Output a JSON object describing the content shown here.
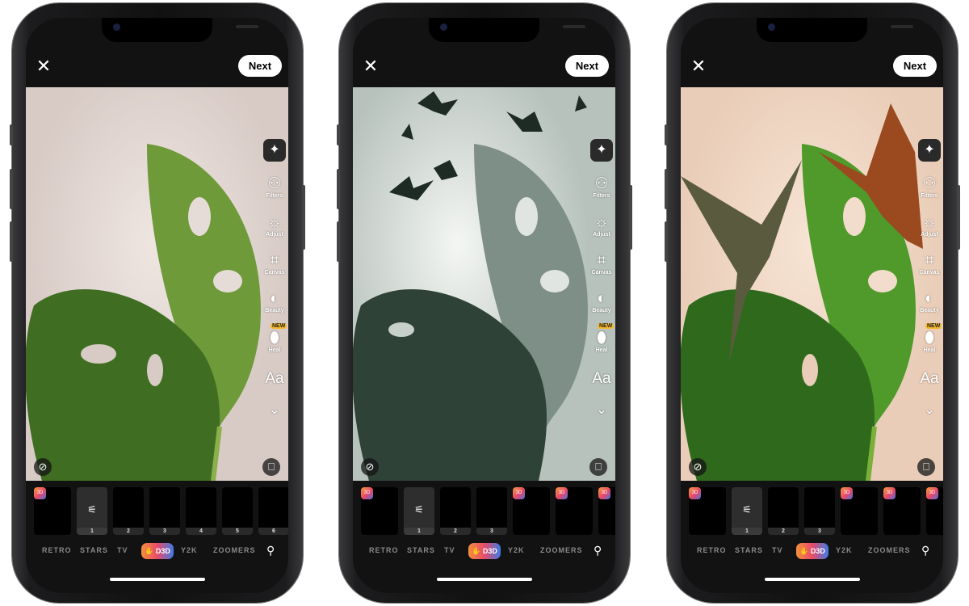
{
  "phones": [
    {
      "id": "original",
      "header": {
        "next_label": "Next"
      },
      "photo_style": "original",
      "thumbnails": [
        {
          "type": "badge"
        },
        {
          "type": "adjust",
          "num": "1"
        },
        {
          "type": "plain",
          "num": "2"
        },
        {
          "type": "plain",
          "num": "3"
        },
        {
          "type": "plain",
          "num": "4"
        },
        {
          "type": "plain",
          "num": "5"
        },
        {
          "type": "plain",
          "num": "6"
        }
      ]
    },
    {
      "id": "bats",
      "header": {
        "next_label": "Next"
      },
      "photo_style": "bats",
      "thumbnails": [
        {
          "type": "badge"
        },
        {
          "type": "adjust",
          "num": "1"
        },
        {
          "type": "plain",
          "num": "2"
        },
        {
          "type": "plain",
          "num": "3"
        },
        {
          "type": "badge"
        },
        {
          "type": "badge"
        },
        {
          "type": "badge"
        }
      ]
    },
    {
      "id": "dragons",
      "header": {
        "next_label": "Next"
      },
      "photo_style": "dragons",
      "thumbnails": [
        {
          "type": "badge"
        },
        {
          "type": "adjust",
          "num": "1"
        },
        {
          "type": "plain",
          "num": "2"
        },
        {
          "type": "plain",
          "num": "3"
        },
        {
          "type": "badge"
        },
        {
          "type": "badge"
        },
        {
          "type": "badge"
        }
      ]
    }
  ],
  "tools": [
    {
      "name": "filters",
      "label": "Filters",
      "icon": "filters-icon"
    },
    {
      "name": "adjust",
      "label": "Adjust",
      "icon": "adjust-icon"
    },
    {
      "name": "canvas",
      "label": "Canvas",
      "icon": "crop-icon"
    },
    {
      "name": "beauty",
      "label": "Beauty",
      "icon": "beauty-icon"
    },
    {
      "name": "heal",
      "label": "Heal",
      "icon": "bandage-icon",
      "badge": "NEW"
    }
  ],
  "text_tool": "Aa",
  "badge_text": "D3D",
  "categories": [
    "RETRO",
    "STARS",
    "TV",
    "D3D",
    "Y2K",
    "ZOOMERS"
  ],
  "colors": {
    "accent_gradient": [
      "#f5903a",
      "#e84a6a",
      "#3d7be8"
    ],
    "new_badge": "#f5b82e",
    "background": "#121212"
  }
}
